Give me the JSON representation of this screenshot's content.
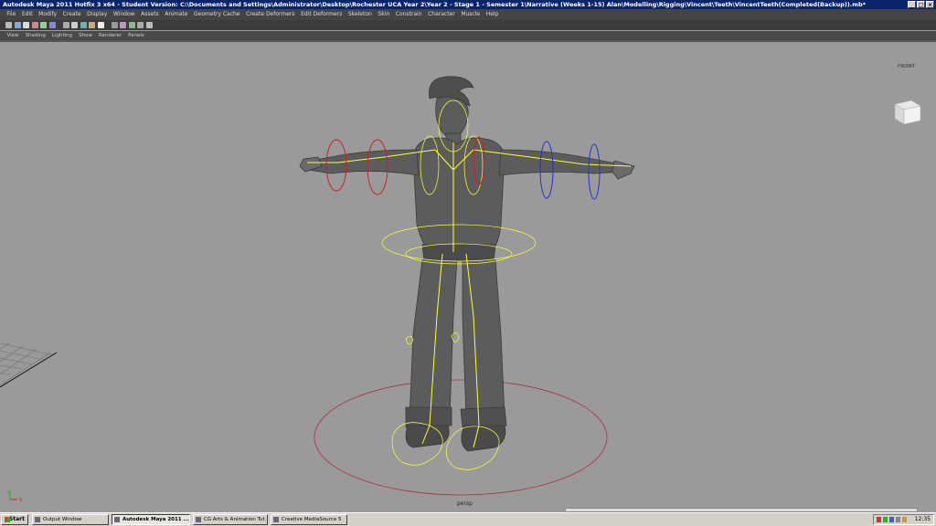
{
  "window": {
    "title": "Autodesk Maya 2011 Hotfix 3 x64 - Student Version: C:\\Documents and Settings\\Administrator\\Desktop\\Rochester UCA Year 2\\Year 2 - Stage 1 - Semester 1\\Narrative (Weeks 1-15) Alan\\Modelling\\Rigging\\Vincent\\Teeth\\VincentTeeth(Completed(Backup)).mb*",
    "minimize": "_",
    "maximize": "□",
    "close": "×"
  },
  "menubar": {
    "items": [
      "File",
      "Edit",
      "Modify",
      "Create",
      "Display",
      "Window",
      "Assets",
      "Animate",
      "Geometry Cache",
      "Create Deformers",
      "Edit Deformers",
      "Skeleton",
      "Skin",
      "Constrain",
      "Character",
      "Muscle",
      "Help"
    ]
  },
  "panel_menu": {
    "items": [
      "View",
      "Shading",
      "Lighting",
      "Show",
      "Renderer",
      "Panels"
    ]
  },
  "viewport": {
    "camera_label": "persp",
    "view_cube_label": "FRONT",
    "axis_y": "Y",
    "axis_x": "X"
  },
  "taskbar": {
    "start": "Start",
    "tasks": [
      {
        "label": "Output Window",
        "active": false
      },
      {
        "label": "Autodesk Maya 2011 ...",
        "active": true
      },
      {
        "label": "CG Arts & Animation Tut...",
        "active": false
      },
      {
        "label": "Creative MediaSource 5",
        "active": false
      }
    ],
    "clock": "12:35"
  },
  "colors": {
    "title_bar": "#0a246a",
    "viewport_bg": "#9a9a9a",
    "joint_yellow": "#ffff33",
    "control_red": "#cc2222",
    "control_blue": "#2233cc",
    "root_control": "#b03040"
  },
  "icons": [
    "select-tool-icon",
    "lasso-icon",
    "paint-icon",
    "move-icon",
    "rotate-icon",
    "scale-icon",
    "camera-icon",
    "wireframe-icon",
    "smooth-shade-icon",
    "texture-icon",
    "light-icon",
    "shadow-icon",
    "isolate-icon",
    "xray-icon",
    "grid-icon",
    "resolution-gate-icon"
  ]
}
